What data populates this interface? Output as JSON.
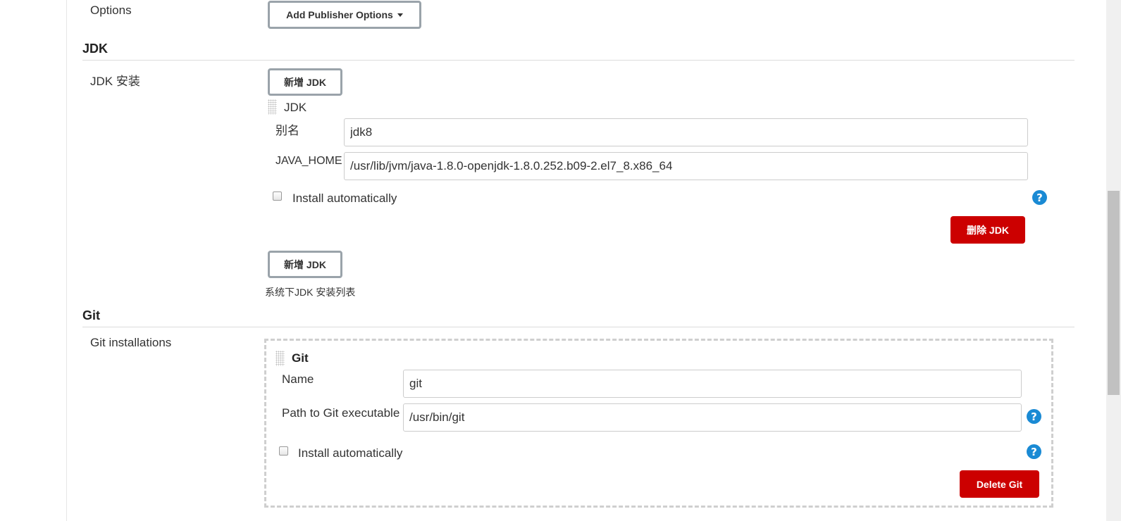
{
  "publisher": {
    "label": "Options",
    "button_label": "Add Publisher Options"
  },
  "jdk": {
    "section_title": "JDK",
    "row_label": "JDK 安装",
    "add_button_label": "新增 JDK",
    "item": {
      "title": "JDK",
      "alias_label": "别名",
      "alias_value": "jdk8",
      "java_home_label": "JAVA_HOME",
      "java_home_value": "/usr/lib/jvm/java-1.8.0-openjdk-1.8.0.252.b09-2.el7_8.x86_64",
      "install_auto_label": "Install automatically",
      "install_auto_checked": false,
      "delete_button_label": "删除 JDK"
    },
    "add_button_label_bottom": "新增 JDK",
    "description": "系统下JDK 安装列表"
  },
  "git": {
    "section_title": "Git",
    "row_label": "Git installations",
    "item": {
      "title": "Git",
      "name_label": "Name",
      "name_value": "git",
      "path_label": "Path to Git executable",
      "path_value": "/usr/bin/git",
      "install_auto_label": "Install automatically",
      "install_auto_checked": false,
      "delete_button_label": "Delete Git"
    }
  },
  "icons": {
    "help": "?"
  },
  "colors": {
    "danger": "#cc0000",
    "help": "#1a8ad4"
  }
}
